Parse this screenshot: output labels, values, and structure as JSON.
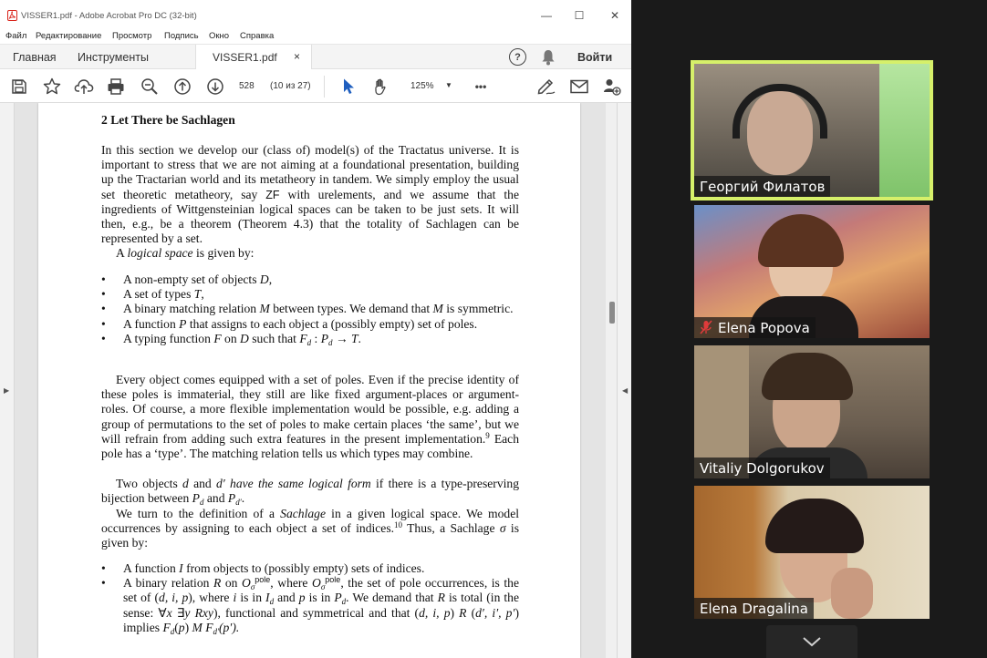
{
  "window": {
    "title": "VISSER1.pdf - Adobe Acrobat Pro DC (32-bit)",
    "controls": {
      "minimize": "—",
      "maximize": "☐",
      "close": "✕"
    }
  },
  "menu": [
    "Файл",
    "Редактирование",
    "Просмотр",
    "Подпись",
    "Окно",
    "Справка"
  ],
  "tabs": {
    "home": "Главная",
    "tools": "Инструменты",
    "document": "VISSER1.pdf",
    "close": "×",
    "help": "?",
    "signin": "Войти"
  },
  "toolbar": {
    "page_number": "528",
    "page_count": "(10 из 27)",
    "zoom": "125%",
    "more": "•••",
    "icons": [
      "save-icon",
      "bookmark-star-icon",
      "cloud-upload-icon",
      "print-icon",
      "zoom-out-icon",
      "page-up-icon",
      "page-down-icon",
      "select-cursor-icon",
      "hand-icon",
      "fill-sign-icon",
      "email-icon",
      "add-user-icon"
    ]
  },
  "document": {
    "heading": "2 Let There be Sachlagen",
    "p1_a": "In this section we develop our (class of) model(s) of the Tractatus universe. It is important to stress that we are not aiming at a foundational presentation, building up the Tractarian world and its metatheory in tandem. We simply employ the usual set theoretic metatheory, say ",
    "p1_zf": "ZF",
    "p1_b": " with urelements, and we assume that the ingredients of Wittgensteinian logical spaces can be taken to be just sets. It will then, e.g., be a theorem (Theorem 4.3) that the totality of Sachlagen can be represented by a set.",
    "p2_a": "A ",
    "p2_term": "logical space",
    "p2_b": " is given by:",
    "list1": [
      {
        "a": "A non-empty set of objects ",
        "v": "D",
        "b": ","
      },
      {
        "a": "A set of types ",
        "v": "T",
        "b": ","
      },
      {
        "a": "A binary matching relation ",
        "v": "M",
        "b": " between types. We demand that ",
        "v2": "M",
        "c": " is symmetric."
      },
      {
        "a": "A function ",
        "v": "P",
        "b": " that assigns to each object a (possibly empty) set of poles."
      },
      {
        "a": "A typing function ",
        "v": "F",
        "b": " on ",
        "v2": "D",
        "c": " such that ",
        "f": "F",
        "fs": "d",
        "d": " : ",
        "p": "P",
        "ps": "d",
        "e": " → ",
        "t": "T",
        "g": "."
      }
    ],
    "p3_a": "Every object comes equipped with a set of poles. Even if the precise identity of these poles is immaterial, they still are like fixed argument-places or argument-roles. Of course, a more flexible implementation would be possible, e.g. adding a group of permutations to the set of poles to make certain places ‘the same’, but we will refrain from adding such extra features in the present implementation.",
    "p3_fn": "9",
    "p3_b": " Each pole has a ‘type’. The matching relation tells us which types may combine.",
    "p4_a": "Two objects ",
    "p4_d": "d",
    "p4_and": " and ",
    "p4_d2": "d′",
    "p4_term": " have the same logical form",
    "p4_b": " if there is a type-preserving bijection between ",
    "p4_p": "P",
    "p4_ps": "d",
    "p4_and2": " and ",
    "p4_p2": "P",
    "p4_ps2": "d′",
    "p4_end": ".",
    "p5_a": "We turn to the definition of a ",
    "p5_term": "Sachlage",
    "p5_b": " in a given logical space. We model occurrences by assigning to each object a set of indices.",
    "p5_fn": "10",
    "p5_c": " Thus, a Sachlage ",
    "p5_sigma": "σ",
    "p5_d": " is given by:",
    "list2_1a": "A function ",
    "list2_1v": "I",
    "list2_1b": " from objects to (possibly empty) sets of indices.",
    "list2_2a": "A binary relation ",
    "list2_2v": "R",
    "list2_2b": " on ",
    "list2_2o": "O",
    "list2_2sub": "σ",
    "list2_2sup": "pole",
    "list2_2c": ", where ",
    "list2_2d": ", the set of pole occurrences, is the set of (",
    "list2_2e": "d, i, p",
    "list2_2f": "), where ",
    "list2_2g": "i",
    "list2_2h": " is in ",
    "list2_2I": "I",
    "list2_2Is": "d",
    "list2_2i": " and ",
    "list2_2p": "p",
    "list2_2j": " is in ",
    "list2_2P": "P",
    "list2_2Ps": "d",
    "list2_2k": ". We demand that ",
    "list2_2R": "R",
    "list2_2l": " is total (in the sense: ∀",
    "list2_2x": "x",
    "list2_2m": " ∃",
    "list2_2y": "y Rxy",
    "list2_2n": "), functional and symmetrical and that (",
    "list2_2q": "d, i, p",
    "list2_2r": ") ",
    "list2_2R2": "R",
    "list2_2s": " (",
    "list2_2t": "d′, i′, p′",
    "list2_2u": ") implies ",
    "list2_2F": "F",
    "list2_2Fs": "d",
    "list2_2w": "(",
    "list2_2pp": "p",
    "list2_2z": ") ",
    "list2_2M": "M F",
    "list2_2Ms": "d′",
    "list2_2end": "(p′)."
  },
  "participants": [
    {
      "name": "Георгий Филатов",
      "active": true,
      "muted": false,
      "bg": "#7c7468"
    },
    {
      "name": "Elena Popova",
      "active": false,
      "muted": true,
      "bg": "#b45a3c"
    },
    {
      "name": "Vitaliy Dolgorukov",
      "active": false,
      "muted": false,
      "bg": "#8a7a66"
    },
    {
      "name": "Elena Dragalina",
      "active": false,
      "muted": false,
      "bg": "#9c6a3a"
    }
  ],
  "colors": {
    "active_speaker": "#d6f06a",
    "muted": "#e03b3b",
    "acrobat_red": "#d9251c"
  }
}
